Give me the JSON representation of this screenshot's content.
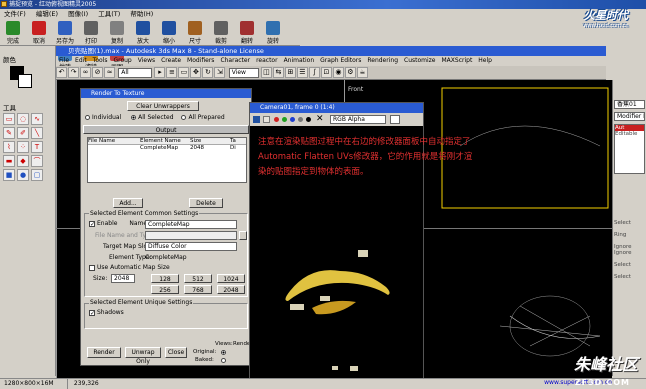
{
  "app_title": "捕捉预览 - 红动俯视图精灵2005",
  "site_logo": {
    "main": "火星时代",
    "sub": "www.hxsd.com.cn"
  },
  "menu": [
    "文件(F)",
    "编辑(E)",
    "图像(I)",
    "工具(T)",
    "帮助(H)"
  ],
  "big_toolbar": [
    {
      "label": "完成",
      "icon": "check-icon",
      "color": "#2a8a2a"
    },
    {
      "label": "取消",
      "icon": "cancel-icon",
      "color": "#c82020"
    },
    {
      "label": "另存为",
      "icon": "save-as-icon",
      "color": "#3060c0"
    },
    {
      "label": "打印",
      "icon": "print-icon",
      "color": "#606060"
    },
    {
      "label": "复制",
      "icon": "copy-icon",
      "color": "#808080"
    },
    {
      "label": "放大",
      "icon": "zoom-in-icon",
      "color": "#2050a0"
    },
    {
      "label": "缩小",
      "icon": "zoom-out-icon",
      "color": "#2050a0"
    },
    {
      "label": "尺寸",
      "icon": "resize-icon",
      "color": "#a06020"
    },
    {
      "label": "裁剪",
      "icon": "crop-icon",
      "color": "#606060"
    },
    {
      "label": "翻转",
      "icon": "flip-icon",
      "color": "#a03030"
    },
    {
      "label": "旋转",
      "icon": "rotate-icon",
      "color": "#3070b0"
    },
    {
      "label": "灰色",
      "icon": "grayscale-icon",
      "color": "#808080"
    },
    {
      "label": "擦除",
      "icon": "eraser-icon",
      "color": "#d04040"
    },
    {
      "label": "地砖",
      "icon": "tile-icon",
      "color": "#4080c0"
    },
    {
      "label": "滤镜",
      "icon": "filter-icon",
      "color": "#d09020"
    },
    {
      "label": "画图",
      "icon": "paint-icon",
      "color": "#c04040"
    }
  ],
  "left_panel": {
    "color_label": "颜色",
    "tools_label": "工具"
  },
  "max_window": {
    "title": "贝壳贴图(1).max - Autodesk 3ds Max 8 - Stand-alone License",
    "menu": [
      "File",
      "Edit",
      "Tools",
      "Group",
      "Views",
      "Create",
      "Modifiers",
      "Character",
      "reactor",
      "Animation",
      "Graph Editors",
      "Rendering",
      "Customize",
      "MAXScript",
      "Help"
    ],
    "selection_filter": "All",
    "ref_coord": "View"
  },
  "viewports": {
    "front_label": "Front"
  },
  "right_panel": {
    "object_name": "香蕉01",
    "modifier_list": "Modifier List",
    "items": [
      "Aut",
      "Editable"
    ],
    "labels": [
      "Select",
      "Ring",
      "Ignore",
      "Ignore",
      "Select",
      "Select"
    ]
  },
  "rtt": {
    "title": "Render To Texture",
    "clear_btn": "Clear Unwrappers",
    "modes": [
      {
        "label": "Individual",
        "on": false
      },
      {
        "label": "All Selected",
        "on": true
      },
      {
        "label": "All Prepared",
        "on": false
      }
    ],
    "output_header": "Output",
    "columns": [
      "File Name",
      "Element Name",
      "Size",
      "Ta"
    ],
    "rows": [
      {
        "file": "",
        "element": "CompleteMap",
        "size": "2048",
        "ta": "Di"
      }
    ],
    "add_btn": "Add...",
    "delete_btn": "Delete",
    "common_group": "Selected Element Common Settings",
    "enable_label": "Enable",
    "name_label": "Name:",
    "name_value": "CompleteMap",
    "file_label": "File Name and Type",
    "target_label": "Target Map Slot:",
    "target_value": "Diffuse Color",
    "element_type_label": "Element Type:",
    "element_type_value": "CompleteMap",
    "auto_size_label": "Use Automatic Map Size",
    "size_label": "Size:",
    "size_value": "2048",
    "sizes": [
      "128",
      "512",
      "1024",
      "256",
      "768",
      "2048"
    ],
    "unique_group": "Selected Element Unique Settings",
    "shadows_label": "Shadows",
    "render_btn": "Render",
    "unwrap_btn": "Unwrap Only",
    "close_btn": "Close",
    "views_label": "Views:",
    "render_label": "Render",
    "original_label": "Original:",
    "baked_label": "Baked:"
  },
  "frame_window": {
    "title": "Camera01, frame 0 (1:4)",
    "channel": "RGB Alpha"
  },
  "annotation": {
    "lines": [
      "注意在渲染贴图过程中在右边的修改器面板中自动指定了",
      "Automatic Flatten UVs修改器，它的作用就是将刚才渲",
      "染的贴图指定到物体的表面。"
    ]
  },
  "status": {
    "dims": "1280×800×16M",
    "coords": "239,326",
    "url": "www.supersoft.com.cn"
  },
  "watermark": {
    "main": "朱峰社区",
    "sub": "ZF3D.COM"
  }
}
